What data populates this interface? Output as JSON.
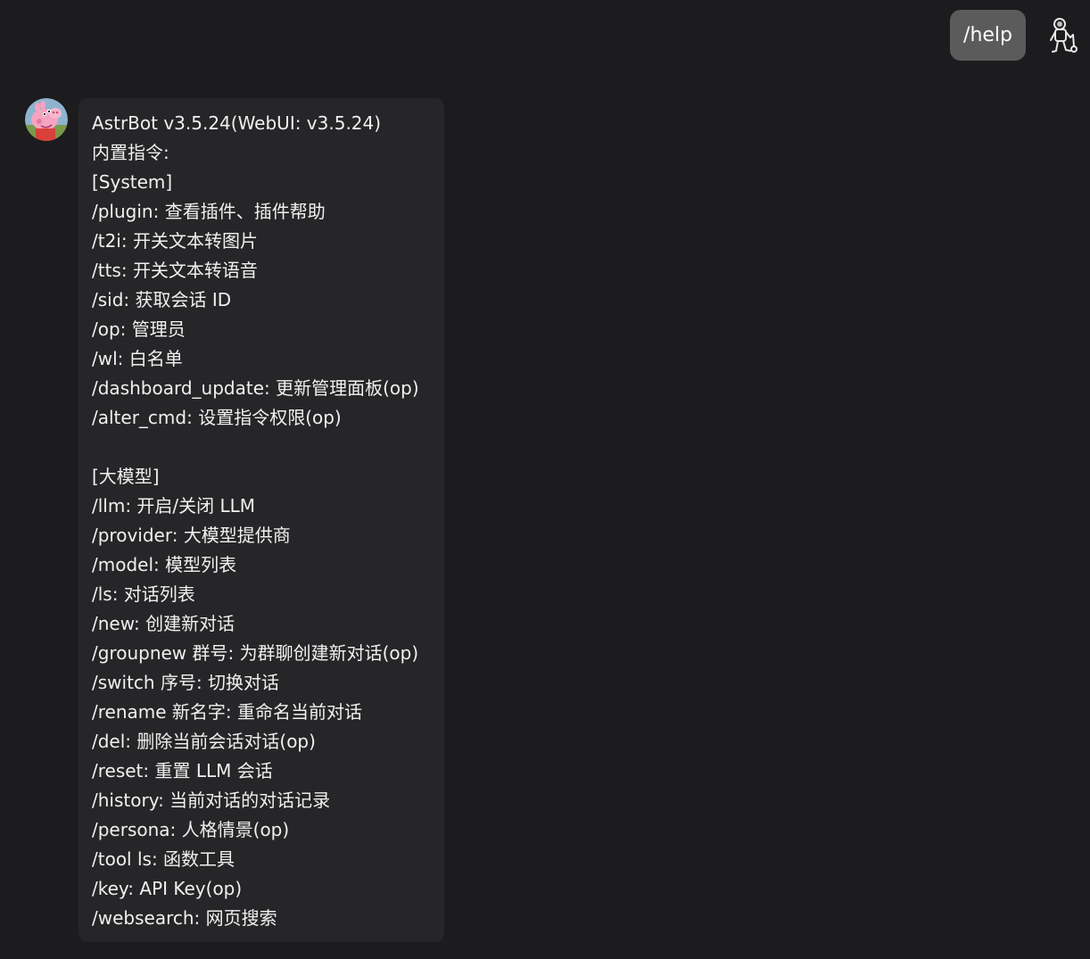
{
  "user_message": {
    "text": "/help",
    "avatar_icon": "astronaut-icon"
  },
  "bot_message": {
    "avatar_icon": "peppa-pig-avatar",
    "lines": [
      "AstrBot v3.5.24(WebUI: v3.5.24)",
      "内置指令:",
      "[System]",
      "/plugin: 查看插件、插件帮助",
      "/t2i: 开关文本转图片",
      "/tts: 开关文本转语音",
      "/sid: 获取会话 ID",
      "/op: 管理员",
      "/wl: 白名单",
      "/dashboard_update: 更新管理面板(op)",
      "/alter_cmd: 设置指令权限(op)",
      "",
      "[大模型]",
      "/llm: 开启/关闭 LLM",
      "/provider: 大模型提供商",
      "/model: 模型列表",
      "/ls: 对话列表",
      "/new: 创建新对话",
      "/groupnew 群号: 为群聊创建新对话(op)",
      "/switch 序号: 切换对话",
      "/rename 新名字: 重命名当前对话",
      "/del: 删除当前会话对话(op)",
      "/reset: 重置 LLM 会话",
      "/history: 当前对话的对话记录",
      "/persona: 人格情景(op)",
      "/tool ls: 函数工具",
      "/key: API Key(op)",
      "/websearch: 网页搜索"
    ]
  },
  "colors": {
    "background": "#1c1b1d",
    "user_bubble": "#5b5b5b",
    "bot_bubble": "#262628"
  }
}
